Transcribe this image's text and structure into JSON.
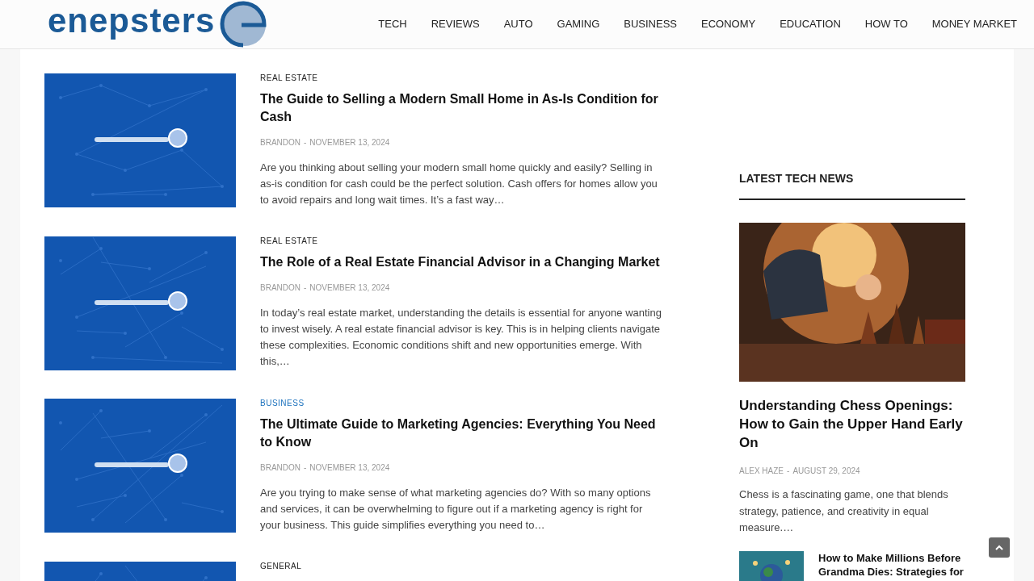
{
  "header": {
    "logo": "enepsters",
    "nav": [
      {
        "label": "TECH"
      },
      {
        "label": "REVIEWS"
      },
      {
        "label": "AUTO"
      },
      {
        "label": "GAMING"
      },
      {
        "label": "BUSINESS"
      },
      {
        "label": "ECONOMY"
      },
      {
        "label": "EDUCATION"
      },
      {
        "label": "HOW TO"
      },
      {
        "label": "MONEY MARKET"
      }
    ]
  },
  "posts": [
    {
      "category": "REAL ESTATE",
      "color": "#222222",
      "title": "The Guide to Selling a Modern Small Home in As-Is Condition for Cash",
      "author": "BRANDON",
      "separator": "-",
      "date": "NOVEMBER 13, 2024",
      "excerpt": "Are you thinking about selling your modern small home quickly and easily? Selling in as-is condition for cash could be the perfect solution. Cash offers for homes allow you to avoid repairs and long wait times. It’s a fast way…"
    },
    {
      "category": "REAL ESTATE",
      "color": "#222222",
      "title": "The Role of a Real Estate Financial Advisor in a Changing Market",
      "author": "BRANDON",
      "separator": "-",
      "date": "NOVEMBER 13, 2024",
      "excerpt": "In today’s real estate market, understanding the details is essential for anyone wanting to invest wisely. A real estate financial advisor is key. This is in helping clients navigate these complexities. Economic conditions shift and new opportunities emerge. With this,…"
    },
    {
      "category": "BUSINESS",
      "color": "#1e73be",
      "title": "The Ultimate Guide to Marketing Agencies: Everything You Need to Know",
      "author": "BRANDON",
      "separator": "-",
      "date": "NOVEMBER 13, 2024",
      "excerpt": "Are you trying to make sense of what marketing agencies do? With so many options and services, it can be overwhelming to figure out if a marketing agency is right for your business. This guide simplifies everything you need to…"
    },
    {
      "category": "GENERAL",
      "color": "#222222"
    }
  ],
  "sidebar": {
    "heading": "LATEST TECH NEWS",
    "featured": {
      "title": "Understanding Chess Openings: How to Gain the Upper Hand Early On",
      "author": "ALEX HAZE",
      "separator": "-",
      "date": "AUGUST 29, 2024",
      "excerpt": "Chess is a fascinating game, one that blends strategy, patience, and creativity in equal measure.…"
    },
    "items": [
      {
        "title": "How to Make Millions Before Grandma Dies: Strategies for"
      }
    ]
  }
}
